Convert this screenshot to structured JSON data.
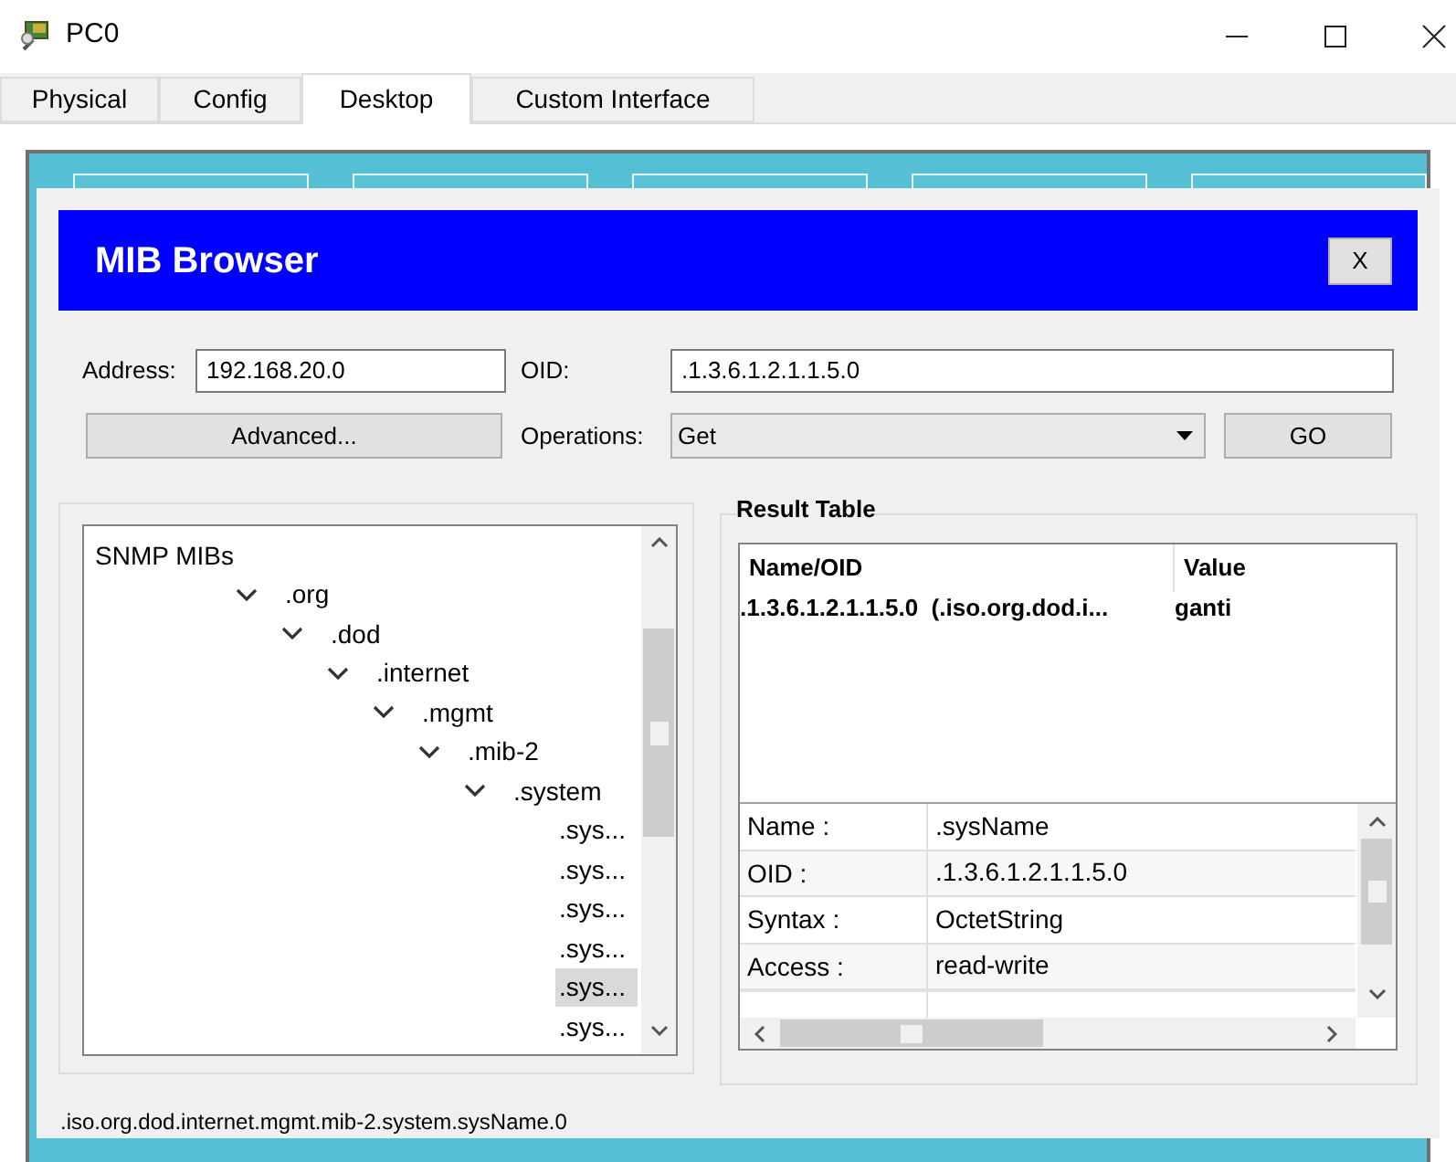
{
  "window": {
    "title": "PC0"
  },
  "tabs": [
    {
      "label": "Physical",
      "selected": false
    },
    {
      "label": "Config",
      "selected": false
    },
    {
      "label": "Desktop",
      "selected": true
    },
    {
      "label": "Custom Interface",
      "selected": false
    }
  ],
  "dialog": {
    "title": "MIB Browser",
    "close_label": "X",
    "address_label": "Address:",
    "address_value": "192.168.20.0",
    "oid_label": "OID:",
    "oid_value": ".1.3.6.1.2.1.1.5.0",
    "advanced_button": "Advanced...",
    "operations_label": "Operations:",
    "operation_value": "Get",
    "go_button": "GO"
  },
  "mib_tree": {
    "label": "SNMP MIBs",
    "children": [
      {
        "label": ".org",
        "expanded": true,
        "children": [
          {
            "label": ".dod",
            "expanded": true,
            "children": [
              {
                "label": ".internet",
                "expanded": true,
                "children": [
                  {
                    "label": ".mgmt",
                    "expanded": true,
                    "children": [
                      {
                        "label": ".mib-2",
                        "expanded": true,
                        "children": [
                          {
                            "label": ".system",
                            "expanded": true,
                            "children": [
                              {
                                "label": ".sys...",
                                "selected": false
                              },
                              {
                                "label": ".sys...",
                                "selected": false
                              },
                              {
                                "label": ".sys...",
                                "selected": false
                              },
                              {
                                "label": ".sys...",
                                "selected": false
                              },
                              {
                                "label": ".sys...",
                                "selected": true
                              },
                              {
                                "label": ".sys...",
                                "selected": false
                              }
                            ]
                          }
                        ]
                      }
                    ]
                  }
                ]
              }
            ]
          }
        ]
      }
    ]
  },
  "result_table": {
    "title": "Result Table",
    "columns": [
      "Name/OID",
      "Value"
    ],
    "rows": [
      {
        "name_oid": ".1.3.6.1.2.1.1.5.0  (.iso.org.dod.i...",
        "value": "ganti"
      }
    ]
  },
  "details": [
    {
      "label": "Name :",
      "value": ".sysName"
    },
    {
      "label": "OID :",
      "value": ".1.3.6.1.2.1.1.5.0"
    },
    {
      "label": "Syntax :",
      "value": "OctetString"
    },
    {
      "label": "Access :",
      "value": "read-write"
    }
  ],
  "status_bar": ".iso.org.dod.internet.mgmt.mib-2.system.sysName.0"
}
